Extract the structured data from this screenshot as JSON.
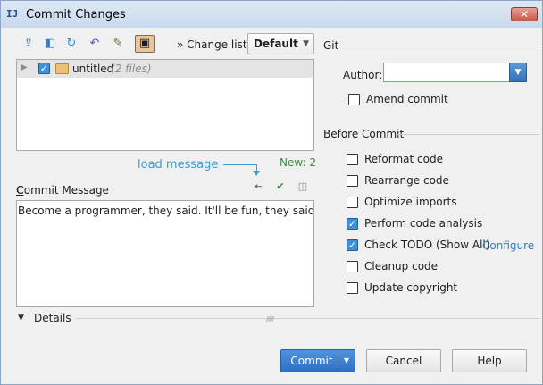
{
  "window": {
    "title": "Commit Changes",
    "close_symbol": "✕"
  },
  "toolbar": {
    "change_list_label": "Change list:",
    "change_list_value": "Default",
    "icons": [
      "update-icon",
      "diff-icon",
      "refresh-icon",
      "rollback-icon",
      "edit-source-icon",
      "group-by-directory-icon"
    ]
  },
  "file_tree": {
    "items": [
      {
        "name": "untitled",
        "count": "(2 files)",
        "checked": true
      }
    ]
  },
  "annotation": {
    "text": "load message",
    "color": "#3b9ad6"
  },
  "commit_message": {
    "label": "Commit Message",
    "new_count": "New: 2",
    "text": "Become a programmer, they said. It'll be fun, they said."
  },
  "details": {
    "label": "Details"
  },
  "git_section": {
    "title": "Git",
    "author_label": "Author:",
    "author_value": "",
    "amend_label": "Amend commit",
    "amend_checked": false
  },
  "before_commit": {
    "title": "Before Commit",
    "options": [
      {
        "label": "Reformat code",
        "checked": false
      },
      {
        "label": "Rearrange code",
        "checked": false
      },
      {
        "label": "Optimize imports",
        "checked": false
      },
      {
        "label": "Perform code analysis",
        "checked": true
      },
      {
        "label": "Check TODO (Show All)",
        "checked": true
      },
      {
        "label": "Cleanup code",
        "checked": false
      },
      {
        "label": "Update copyright",
        "checked": false
      }
    ],
    "configure_link": "Configure"
  },
  "buttons": {
    "commit": "Commit",
    "cancel": "Cancel",
    "help": "Help"
  },
  "colors": {
    "accent": "#3d8fd8",
    "link": "#2f7ec8",
    "new_count": "#3f8f3f"
  }
}
